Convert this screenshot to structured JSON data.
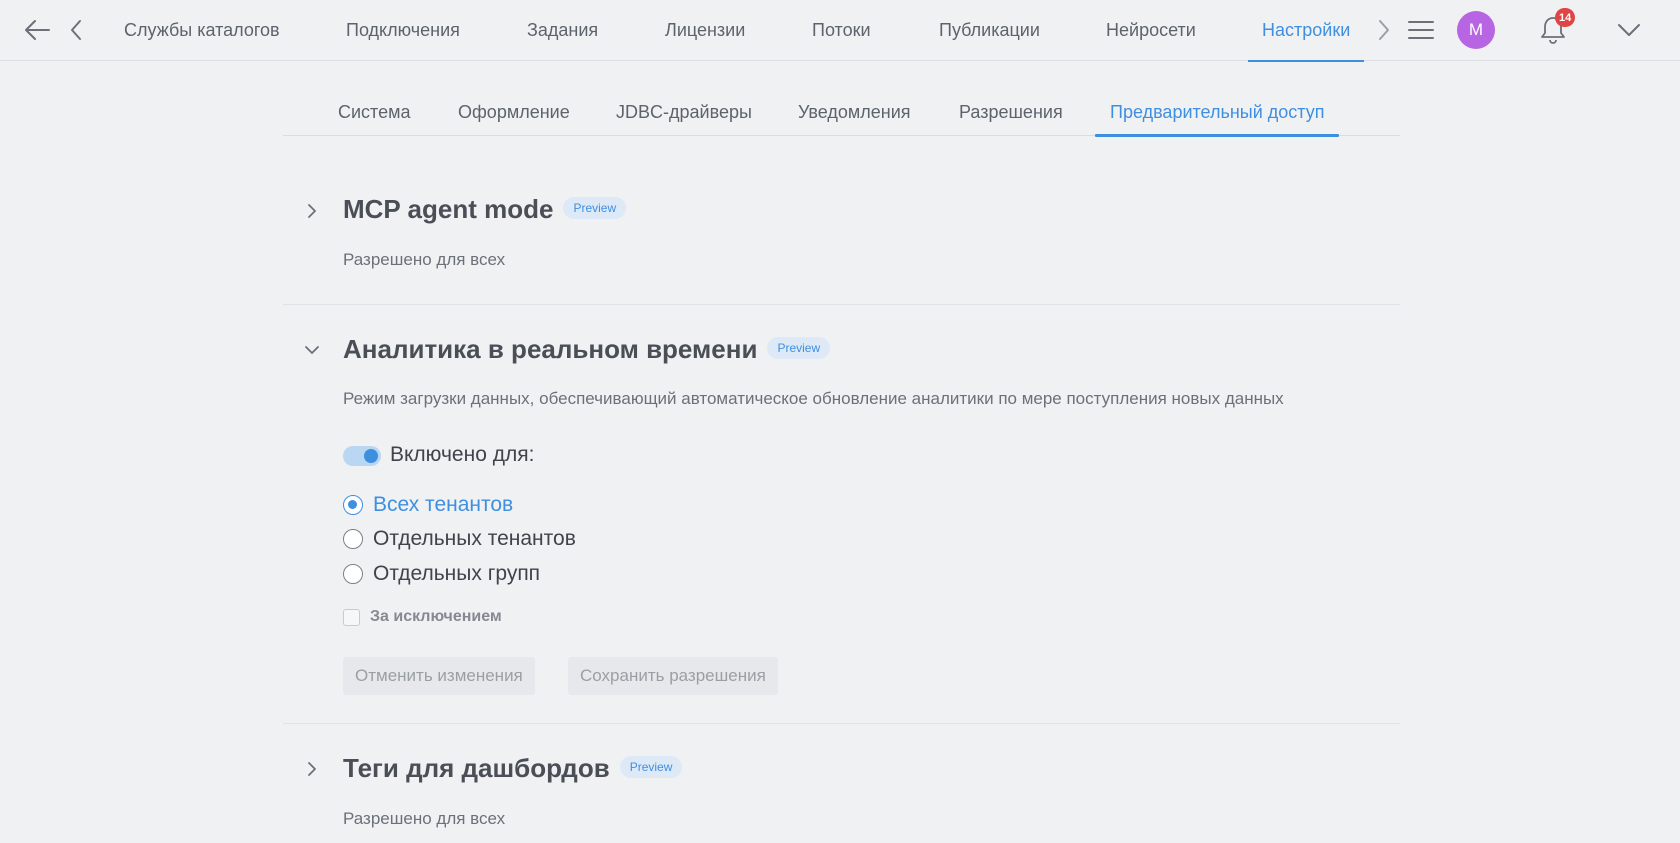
{
  "header": {
    "nav": [
      {
        "label": "Службы каталогов"
      },
      {
        "label": "Подключения"
      },
      {
        "label": "Задания"
      },
      {
        "label": "Лицензии"
      },
      {
        "label": "Потоки"
      },
      {
        "label": "Публикации"
      },
      {
        "label": "Нейросети"
      },
      {
        "label": "Настройки",
        "active": true
      }
    ],
    "avatar_initial": "M",
    "notification_count": "14",
    "icons": [
      "back-arrow-icon",
      "chevron-left-icon",
      "chevron-right-icon",
      "hamburger-menu-icon",
      "bell-icon",
      "chevron-down-icon"
    ],
    "accent_color": "#3f8fe0",
    "avatar_color": "#b865e4",
    "badge_color": "#e04444"
  },
  "subtabs": [
    {
      "label": "Система"
    },
    {
      "label": "Оформление"
    },
    {
      "label": "JDBC-драйверы"
    },
    {
      "label": "Уведомления"
    },
    {
      "label": "Разрешения"
    },
    {
      "label": "Предварительный доступ",
      "active": true
    }
  ],
  "sections": [
    {
      "title": "MCP agent mode",
      "badge": "Preview",
      "expanded": false,
      "status": "Разрешено для всех"
    },
    {
      "title": "Аналитика в реальном времени",
      "badge": "Preview",
      "expanded": true,
      "description": "Режим загрузки данных, обеспечивающий автоматическое обновление аналитики по мере поступления новых данных",
      "toggle_label": "Включено для:",
      "toggle_on": true,
      "options": [
        {
          "label": "Всех тенантов",
          "checked": true
        },
        {
          "label": "Отдельных тенантов",
          "checked": false
        },
        {
          "label": "Отдельных групп",
          "checked": false
        }
      ],
      "exclude_label": "За исключением",
      "exclude_checked": false,
      "cancel_label": "Отменить изменения",
      "save_label": "Сохранить разрешения"
    },
    {
      "title": "Теги для дашбордов",
      "badge": "Preview",
      "expanded": false,
      "status": "Разрешено для всех"
    }
  ]
}
